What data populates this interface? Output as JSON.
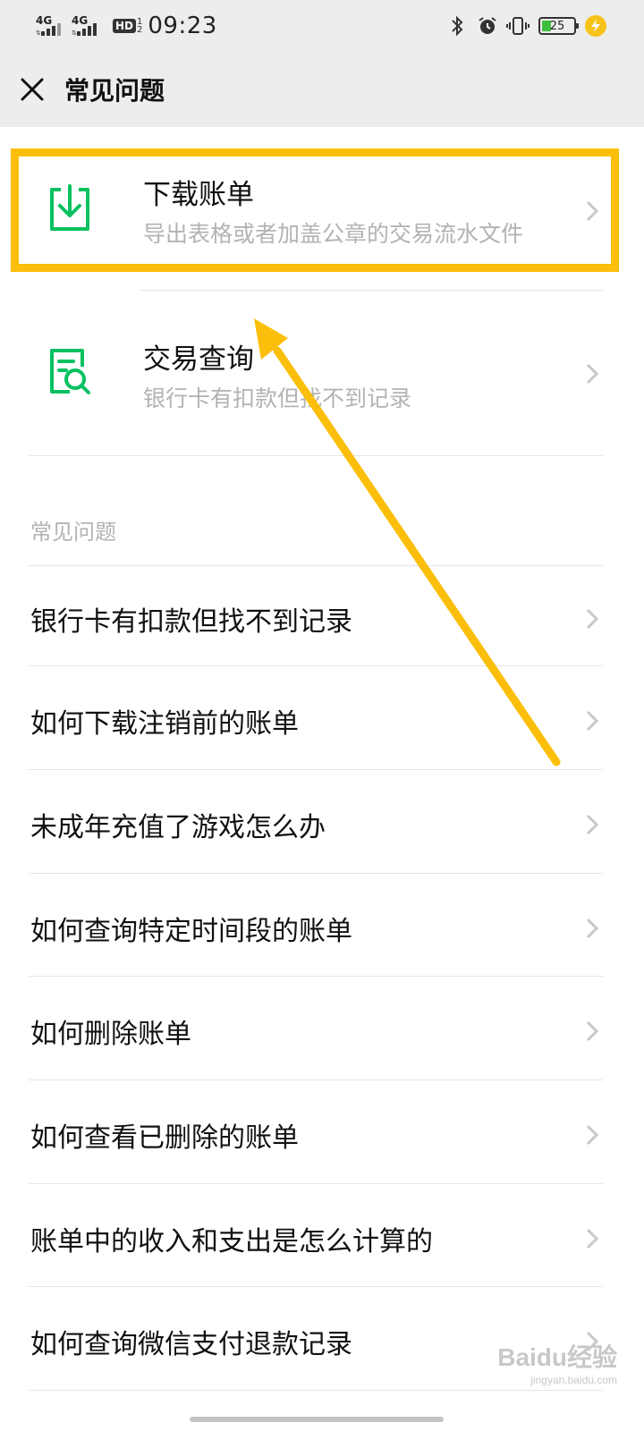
{
  "status_bar": {
    "signal1_label": "4G",
    "signal2_label": "4G",
    "hd_label": "HD",
    "hd_sub_top": "1",
    "hd_sub_bottom": "2",
    "time": "09:23",
    "battery_level": "25",
    "icons": [
      "bluetooth-icon",
      "alarm-icon",
      "vibrate-icon",
      "battery-icon",
      "charging-icon"
    ]
  },
  "header": {
    "close_icon": "close-icon",
    "title": "常见问题"
  },
  "features": [
    {
      "icon": "download-icon",
      "title": "下载账单",
      "subtitle": "导出表格或者加盖公章的交易流水文件"
    },
    {
      "icon": "document-search-icon",
      "title": "交易查询",
      "subtitle": "银行卡有扣款但找不到记录"
    }
  ],
  "section_label": "常见问题",
  "faq_items": [
    "银行卡有扣款但找不到记录",
    "如何下载注销前的账单",
    "未成年充值了游戏怎么办",
    "如何查询特定时间段的账单",
    "如何删除账单",
    "如何查看已删除的账单",
    "账单中的收入和支出是怎么计算的",
    "如何查询微信支付退款记录"
  ],
  "watermark": {
    "main": "Baidu经验",
    "sub": "jingyan.baidu.com"
  },
  "colors": {
    "accent_green": "#07c160",
    "highlight_yellow": "#fbbf0b",
    "header_bg": "#ededed",
    "muted_text": "#b3b3b3"
  }
}
